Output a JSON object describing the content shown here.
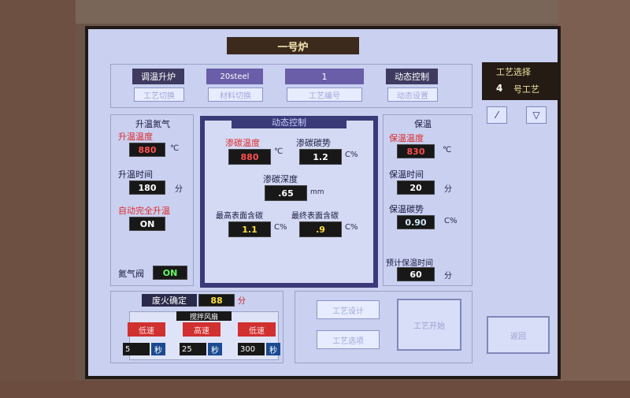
{
  "header": {
    "title": "一号炉"
  },
  "top": {
    "mode_label": "调温升炉",
    "mode_button": "工艺切换",
    "steel_label": "20steel",
    "steel_button": "材料切换",
    "number_label": "1",
    "number_button": "工艺编号",
    "dynamic_label": "动态控制",
    "dynamic_button": "动态设置"
  },
  "process_select": {
    "title": "工艺选择",
    "number": "4",
    "suffix": "号工艺",
    "up_icon": "up-arrow-icon",
    "down_icon": "down-arrow-icon"
  },
  "left": {
    "header": "升温氮气",
    "temp_label": "升温温度",
    "temp_value": "880",
    "temp_unit": "℃",
    "time_label": "升温时间",
    "time_value": "180",
    "time_unit": "分",
    "auto_label": "自动完全升温",
    "auto_value": "ON",
    "nitrogen_label": "氮气阀",
    "nitrogen_value": "ON"
  },
  "center": {
    "title": "动态控制",
    "carb_temp_label": "渗碳温度",
    "carb_temp_value": "880",
    "carb_temp_unit": "℃",
    "carb_potential_label": "渗碳碳势",
    "carb_potential_value": "1.2",
    "carb_potential_unit": "C%",
    "depth_label": "渗碳深度",
    "depth_value": ".65",
    "depth_unit": "mm",
    "max_surface_label": "最高表面含碳",
    "max_surface_value": "1.1",
    "max_surface_unit": "C%",
    "final_surface_label": "最终表面含碳",
    "final_surface_value": ".9",
    "final_surface_unit": "C%"
  },
  "right": {
    "header": "保温",
    "temp_label": "保温温度",
    "temp_value": "830",
    "temp_unit": "℃",
    "time_label": "保温时间",
    "time_value": "20",
    "time_unit": "分",
    "potential_label": "保温碳势",
    "potential_value": "0.90",
    "potential_unit": "C%",
    "est_label": "预计保温时间",
    "est_value": "60",
    "est_unit": "分"
  },
  "bottom": {
    "fire_label": "废火确定",
    "fire_value": "88",
    "fire_unit": "分",
    "stir_label": "搅拌风扇",
    "speeds": [
      {
        "label": "低速",
        "value": "5",
        "unit": "秒"
      },
      {
        "label": "高速",
        "value": "25",
        "unit": "秒"
      },
      {
        "label": "低速",
        "value": "300",
        "unit": "秒"
      }
    ],
    "btn_process_design": "工艺设计",
    "btn_process_option": "工艺选项",
    "btn_process_start": "工艺开始",
    "btn_back": "返回"
  }
}
